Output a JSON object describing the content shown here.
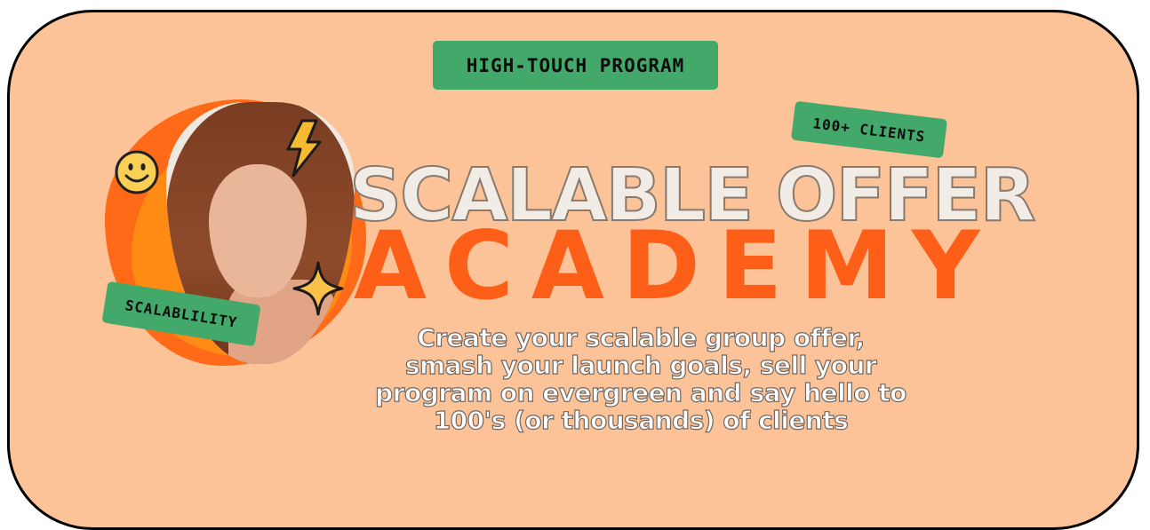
{
  "banner": {
    "background_color": "#fcc298",
    "tags": {
      "top": "HIGH-TOUCH PROGRAM",
      "clients": "100+ CLIENTS",
      "scalability": "SCALABLILITY"
    },
    "title_line1": "SCALABLE OFFER",
    "title_line2": "ACADEMY",
    "subtitle_lines": [
      "Create your scalable group offer,",
      "smash your launch goals, sell your",
      "program on evergreen and say hello to",
      "100's (or thousands) of clients"
    ],
    "icons": {
      "smiley": "smiley-face-icon",
      "bolt": "lightning-bolt-icon",
      "sparkle": "sparkle-star-icon"
    },
    "colors": {
      "tag_green": "#43a96a",
      "accent_orange": "#fe5f18",
      "blob_orange": "#ff6a18"
    }
  }
}
